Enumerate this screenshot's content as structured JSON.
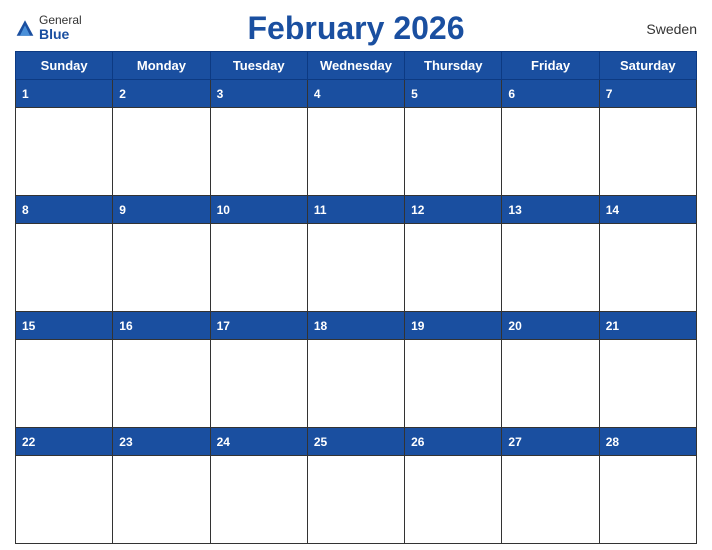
{
  "header": {
    "title": "February 2026",
    "logo_general": "General",
    "logo_blue": "Blue",
    "country": "Sweden"
  },
  "days": [
    "Sunday",
    "Monday",
    "Tuesday",
    "Wednesday",
    "Thursday",
    "Friday",
    "Saturday"
  ],
  "weeks": [
    [
      1,
      2,
      3,
      4,
      5,
      6,
      7
    ],
    [
      8,
      9,
      10,
      11,
      12,
      13,
      14
    ],
    [
      15,
      16,
      17,
      18,
      19,
      20,
      21
    ],
    [
      22,
      23,
      24,
      25,
      26,
      27,
      28
    ]
  ],
  "colors": {
    "header_bg": "#1a4fa0",
    "header_text": "#ffffff",
    "border": "#333333"
  }
}
